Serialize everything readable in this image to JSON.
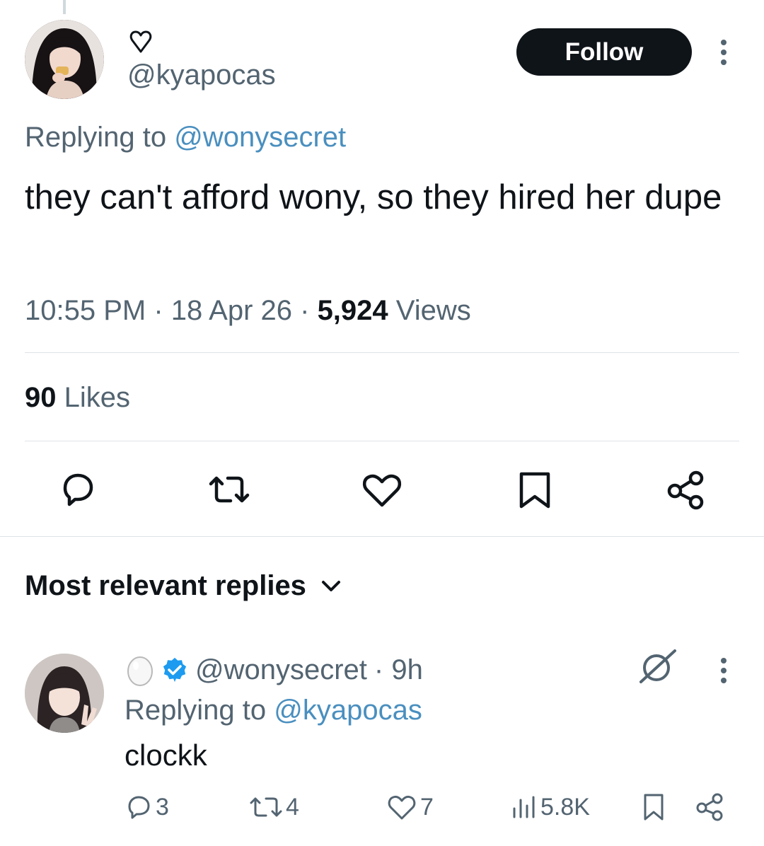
{
  "tweet": {
    "display_name_icon": "heart-outline-icon",
    "handle": "@kyapocas",
    "follow_label": "Follow",
    "replying_prefix": "Replying to ",
    "replying_to": "@wonysecret",
    "text": "they can't afford wony, so they hired her dupe",
    "time": "10:55 PM",
    "date": "18 Apr 26",
    "views_count": "5,924",
    "views_label": " Views",
    "likes_count": "90",
    "likes_label": " Likes"
  },
  "actions": [
    "reply-icon",
    "retweet-icon",
    "like-icon",
    "bookmark-icon",
    "share-icon"
  ],
  "replies_section": {
    "sort_label": "Most relevant replies"
  },
  "reply": {
    "display_name_icon": "egg-icon",
    "verified": true,
    "handle": "@wonysecret",
    "time": "· 9h",
    "replying_prefix": "Replying to ",
    "replying_to": "@kyapocas",
    "text": "clockk",
    "reply_count": "3",
    "retweet_count": "4",
    "like_count": "7",
    "view_count": "5.8K"
  },
  "colors": {
    "link": "#4a8fbf",
    "secondary_text": "#536471",
    "primary_text": "#0f1419",
    "verified": "#1d9bf0"
  }
}
